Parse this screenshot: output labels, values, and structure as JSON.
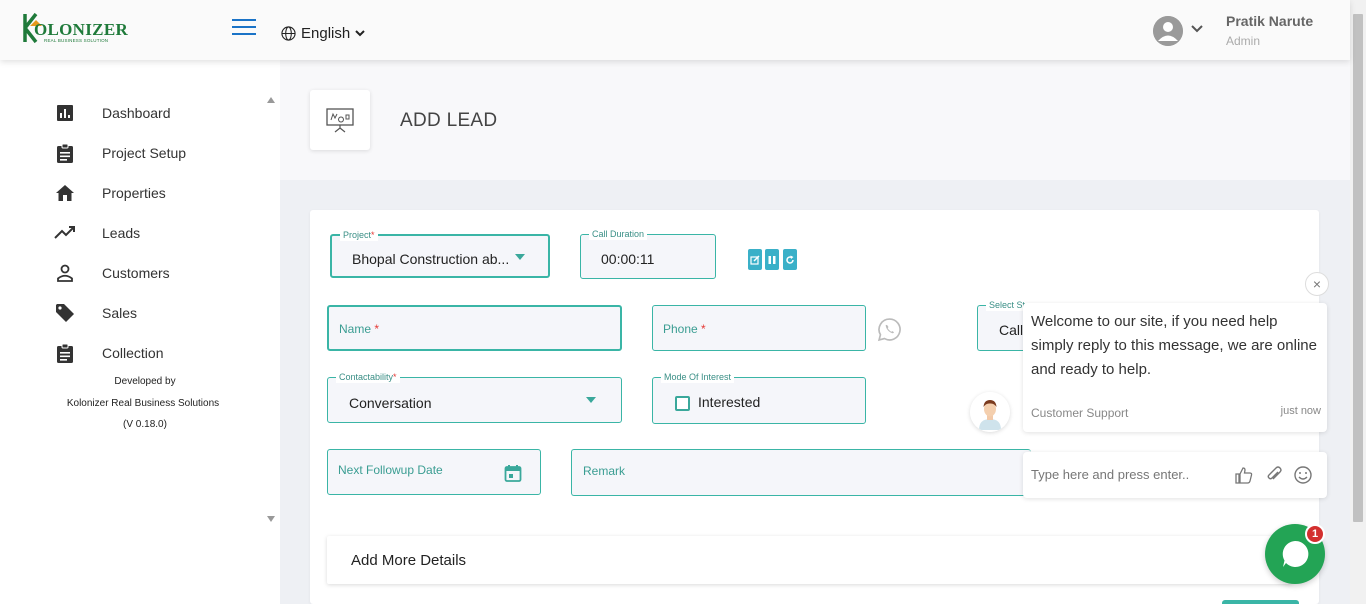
{
  "brand": {
    "logo_text": "OLONIZER",
    "logo_sub": "REAL BUSINESS SOLUTION"
  },
  "header": {
    "language": "English",
    "user_name": "Pratik Narute",
    "user_role": "Admin"
  },
  "sidebar": {
    "items": [
      {
        "label": "Dashboard",
        "icon": "bar-chart-icon"
      },
      {
        "label": "Project Setup",
        "icon": "clipboard-icon"
      },
      {
        "label": "Properties",
        "icon": "home-icon"
      },
      {
        "label": "Leads",
        "icon": "trending-up-icon"
      },
      {
        "label": "Customers",
        "icon": "person-icon"
      },
      {
        "label": "Sales",
        "icon": "tag-icon"
      },
      {
        "label": "Collection",
        "icon": "clipboard-icon"
      }
    ],
    "credits": [
      "Developed by",
      "Kolonizer Real Business Solutions",
      "(V 0.18.0)"
    ]
  },
  "page": {
    "title": "ADD LEAD"
  },
  "form": {
    "project": {
      "label": "Project",
      "value": "Bhopal Construction ab..."
    },
    "call_duration": {
      "label": "Call Duration",
      "value": "00:00:11"
    },
    "name": {
      "placeholder": "Name"
    },
    "phone": {
      "placeholder": "Phone"
    },
    "select_status": {
      "label": "Select St",
      "value": "Call"
    },
    "contactability": {
      "label": "Contactability",
      "value": "Conversation"
    },
    "mode_of_interest": {
      "label": "Mode Of Interest",
      "option": "Interested",
      "checked": false
    },
    "next_followup": {
      "placeholder": "Next Followup Date"
    },
    "remark": {
      "placeholder": "Remark"
    },
    "add_more": "Add More Details",
    "required_mark": "*"
  },
  "chat": {
    "message": "Welcome to our site, if you need help simply reply to this message, we are online and ready to help.",
    "agent": "Customer Support",
    "time": "just now",
    "input_placeholder": "Type here and press enter..",
    "badge": "1",
    "close": "×"
  },
  "colors": {
    "accent": "#3ab5a6",
    "brand": "#1f7a3a",
    "chat": "#23a455",
    "link": "#1a73c7"
  }
}
